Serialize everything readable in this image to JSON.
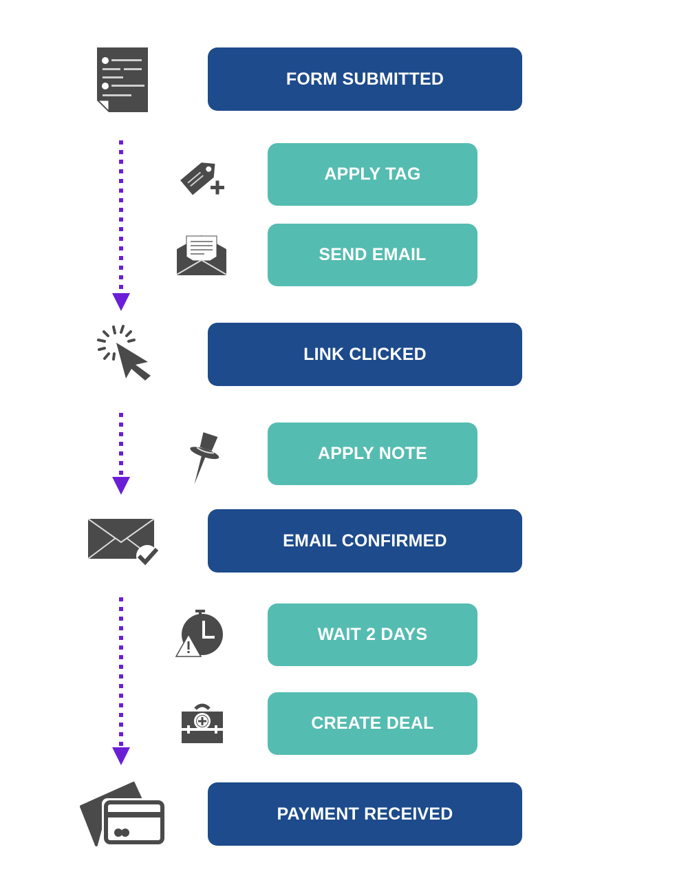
{
  "colors": {
    "trigger": "#1d4b8c",
    "action": "#55bcb1",
    "connector": "#6a1fd6",
    "icon": "#4a4a4a"
  },
  "steps": [
    {
      "type": "trigger",
      "label": "FORM SUBMITTED",
      "icon": "form-document-icon"
    },
    {
      "type": "action",
      "label": "APPLY TAG",
      "icon": "tag-plus-icon"
    },
    {
      "type": "action",
      "label": "SEND EMAIL",
      "icon": "open-envelope-icon"
    },
    {
      "type": "trigger",
      "label": "LINK CLICKED",
      "icon": "cursor-click-icon"
    },
    {
      "type": "action",
      "label": "APPLY NOTE",
      "icon": "pushpin-icon"
    },
    {
      "type": "trigger",
      "label": "EMAIL CONFIRMED",
      "icon": "envelope-check-icon"
    },
    {
      "type": "action",
      "label": "WAIT 2 DAYS",
      "icon": "stopwatch-warning-icon"
    },
    {
      "type": "action",
      "label": "CREATE DEAL",
      "icon": "briefcase-plus-icon"
    },
    {
      "type": "trigger",
      "label": "PAYMENT RECEIVED",
      "icon": "credit-cards-icon"
    }
  ]
}
